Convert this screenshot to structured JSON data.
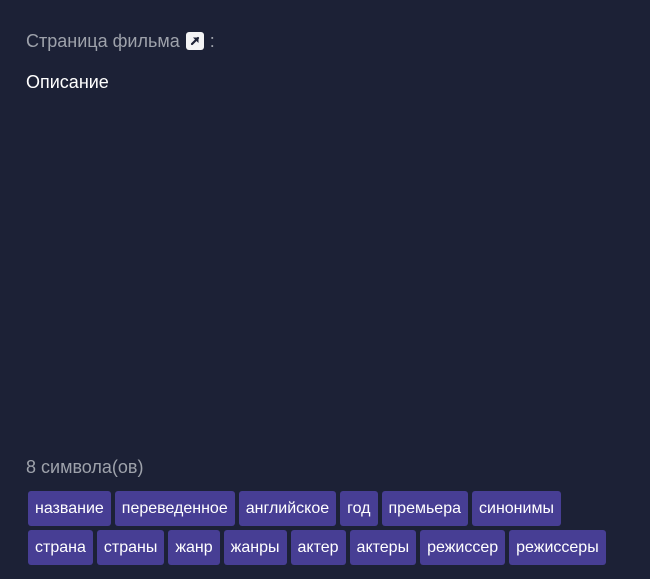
{
  "header": {
    "label": "Страница фильма",
    "colon": ":"
  },
  "description": {
    "label": "Описание"
  },
  "char_count": {
    "text": "8 символа(ов)"
  },
  "tags": [
    "название",
    "переведенное",
    "английское",
    "год",
    "премьера",
    "синонимы",
    "страна",
    "страны",
    "жанр",
    "жанры",
    "актер",
    "актеры",
    "режиссер",
    "режиссеры"
  ],
  "icons": {
    "external_link": "external-link-icon"
  },
  "colors": {
    "background": "#1c2136",
    "muted_text": "#9ea2ab",
    "tag_background": "#473e94",
    "text": "#ffffff"
  }
}
